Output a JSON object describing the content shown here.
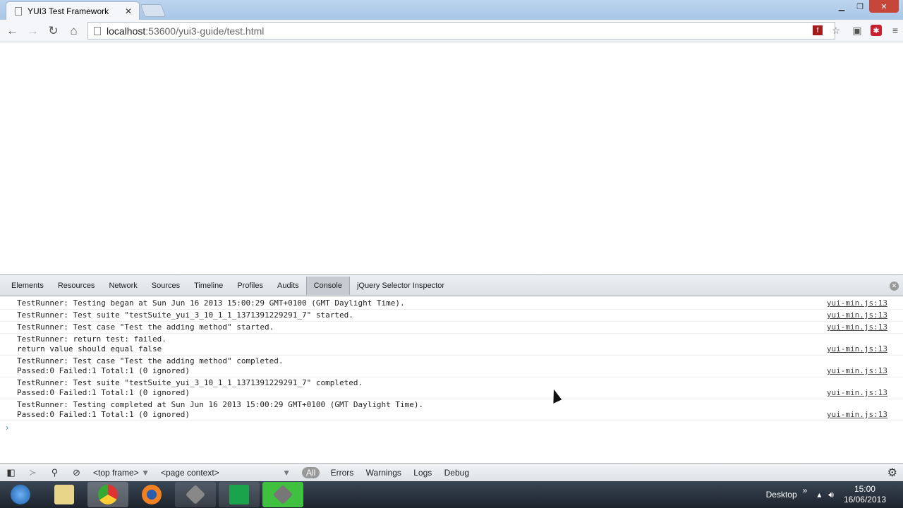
{
  "browser": {
    "tab_title": "YUI3 Test Framework",
    "url_host": "localhost",
    "url_path": ":53600/yui3-guide/test.html"
  },
  "devtools": {
    "tabs": [
      "Elements",
      "Resources",
      "Network",
      "Sources",
      "Timeline",
      "Profiles",
      "Audits",
      "Console",
      "jQuery Selector Inspector"
    ],
    "active_tab": "Console",
    "messages": [
      {
        "lines": [
          "TestRunner: Testing began at Sun Jun 16 2013 15:00:29 GMT+0100 (GMT Daylight Time)."
        ],
        "source": "yui-min.js:13"
      },
      {
        "lines": [
          "TestRunner: Test suite \"testSuite_yui_3_10_1_1_1371391229291_7\" started."
        ],
        "source": "yui-min.js:13"
      },
      {
        "lines": [
          "TestRunner: Test case \"Test the adding method\" started."
        ],
        "source": "yui-min.js:13"
      },
      {
        "lines": [
          "TestRunner: return test: failed.",
          "return value should equal false"
        ],
        "source": "yui-min.js:13"
      },
      {
        "lines": [
          "TestRunner: Test case \"Test the adding method\" completed.",
          "Passed:0 Failed:1 Total:1 (0 ignored)"
        ],
        "source": "yui-min.js:13"
      },
      {
        "lines": [
          "TestRunner: Test suite \"testSuite_yui_3_10_1_1_1371391229291_7\" completed.",
          "Passed:0 Failed:1 Total:1 (0 ignored)"
        ],
        "source": "yui-min.js:13"
      },
      {
        "lines": [
          "TestRunner: Testing completed at Sun Jun 16 2013 15:00:29 GMT+0100 (GMT Daylight Time).",
          "Passed:0 Failed:1 Total:1 (0 ignored)"
        ],
        "source": "yui-min.js:13"
      }
    ],
    "frame_select": "<top frame>",
    "context_select": "<page context>",
    "filters": [
      "All",
      "Errors",
      "Warnings",
      "Logs",
      "Debug"
    ]
  },
  "taskbar": {
    "desktop_label": "Desktop",
    "time": "15:00",
    "date": "16/06/2013"
  }
}
